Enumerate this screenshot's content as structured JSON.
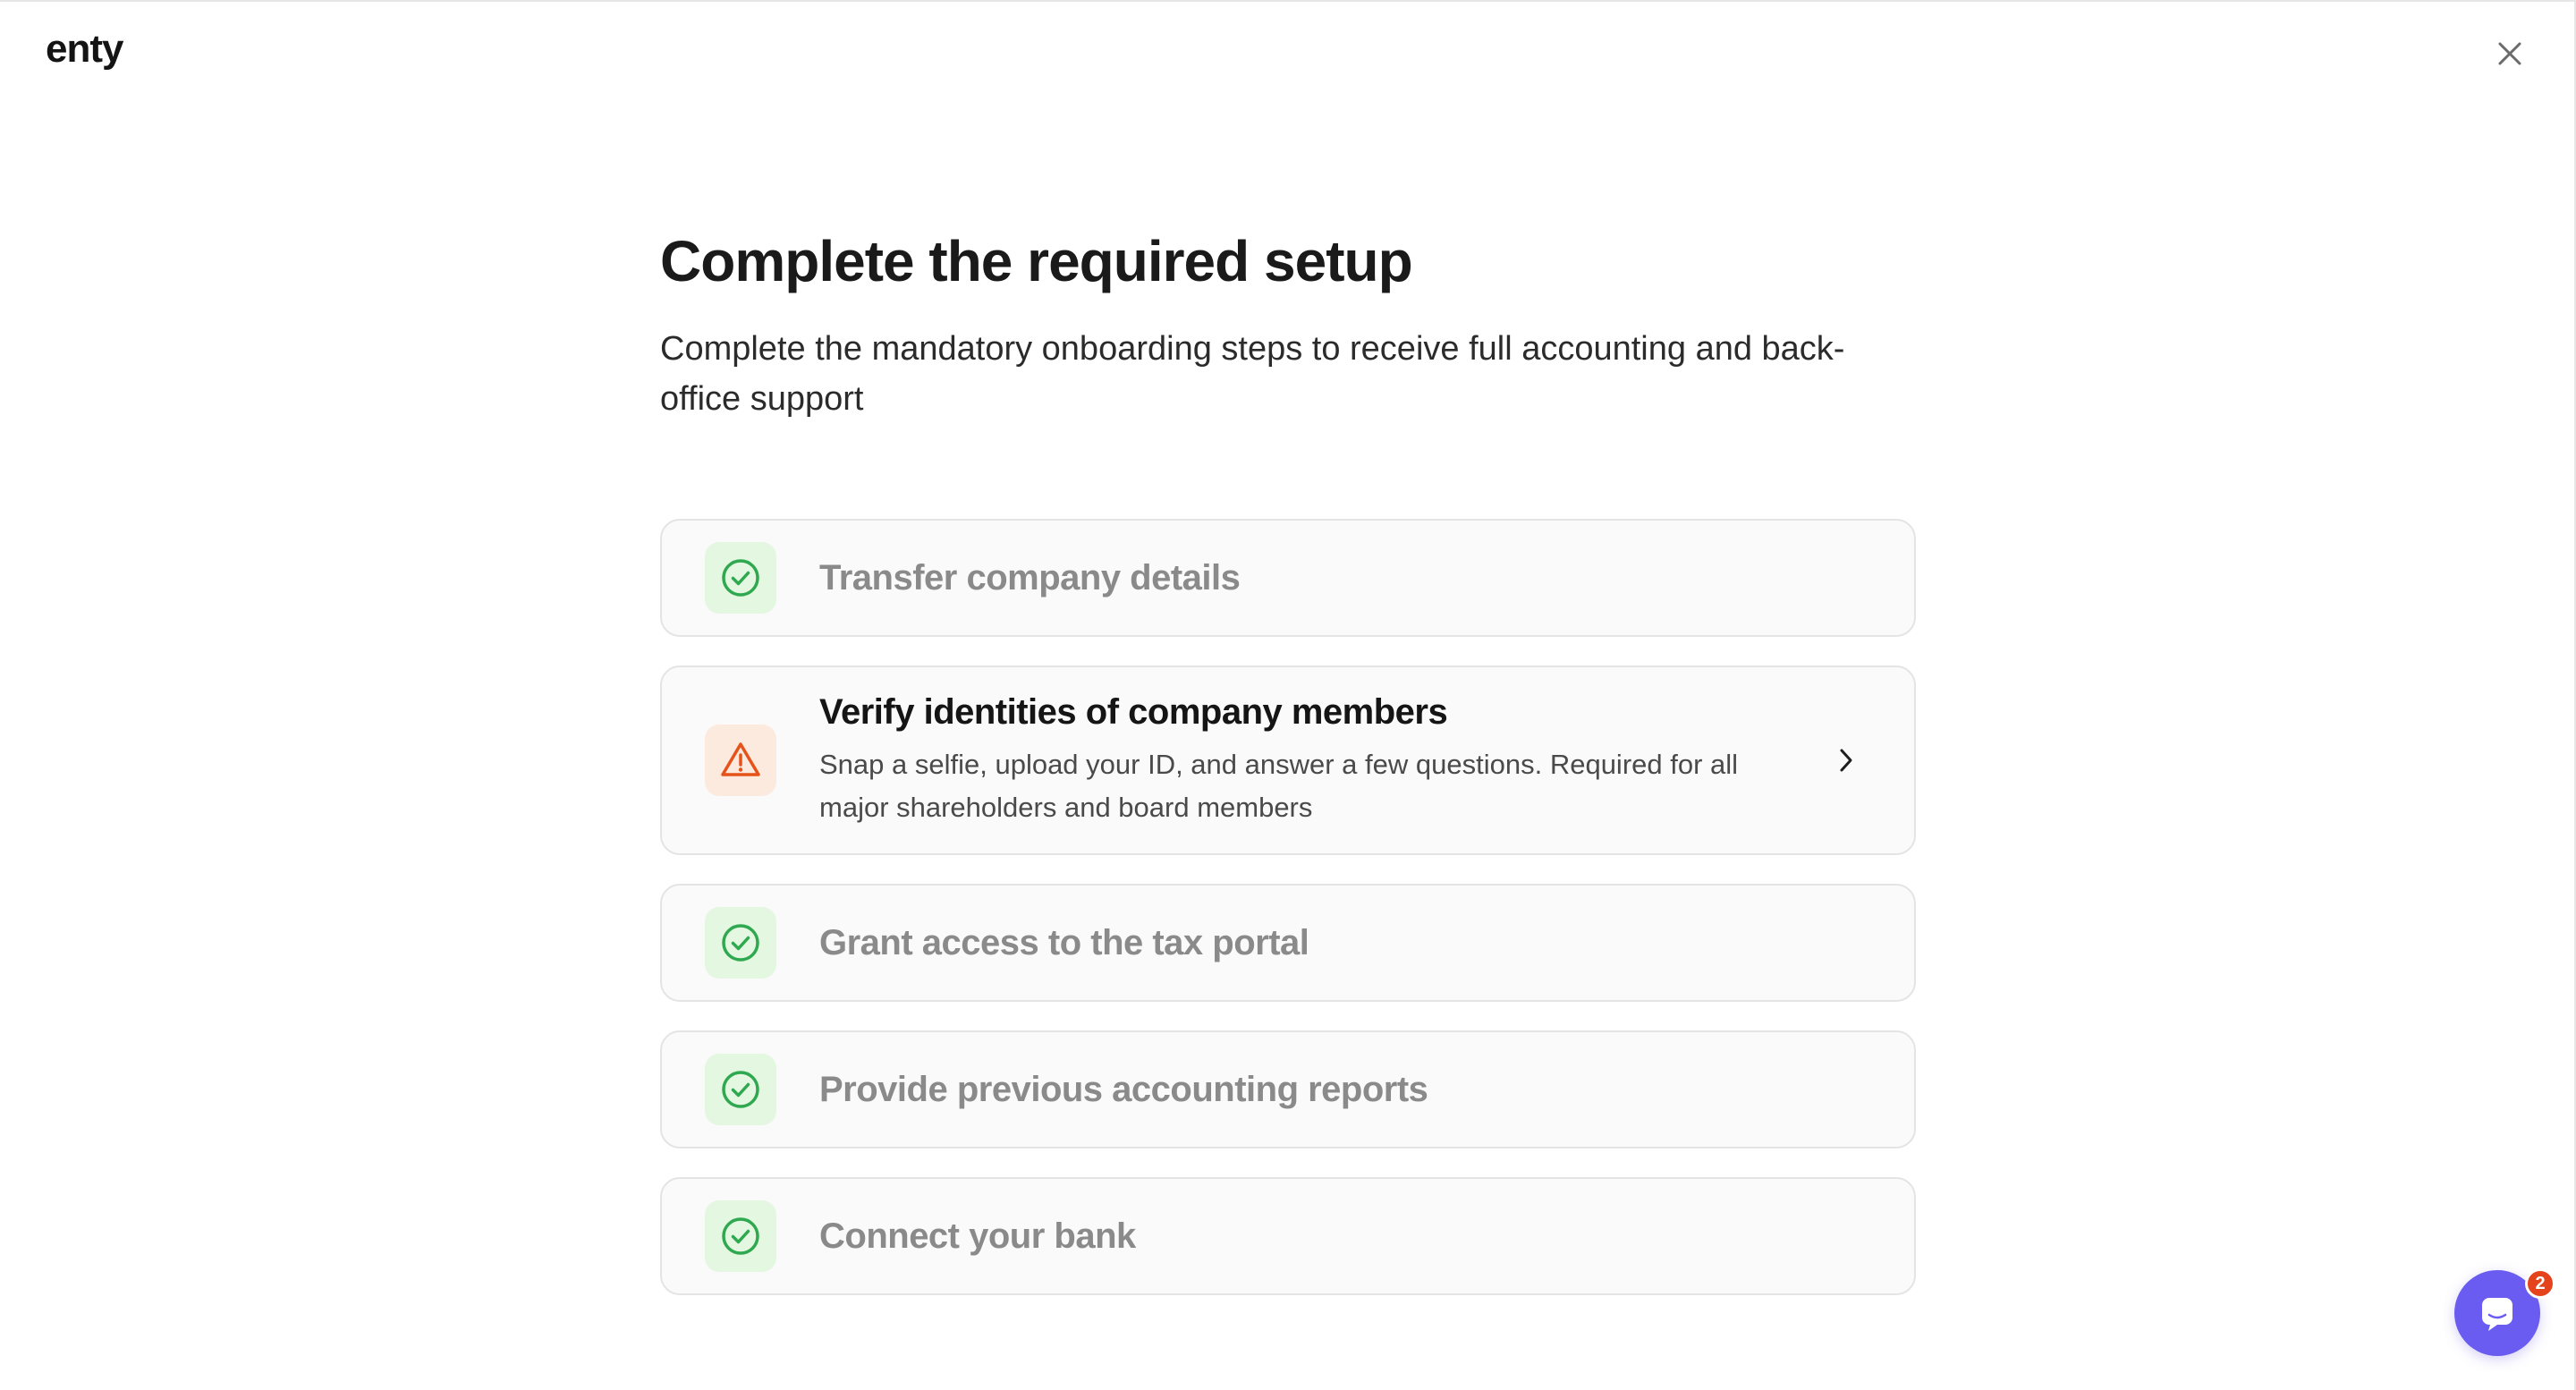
{
  "app": {
    "logo_text": "enty"
  },
  "header": {
    "close_icon": "close-icon"
  },
  "main": {
    "title": "Complete the required setup",
    "subtitle": "Complete the mandatory onboarding steps to receive full accounting and back-office support"
  },
  "steps": [
    {
      "title": "Transfer company details",
      "status": "completed",
      "icon": "check-circle-icon"
    },
    {
      "title": "Verify identities of company members",
      "description": "Snap a selfie, upload your ID, and answer a few questions. Required for all major shareholders and board members",
      "status": "action-required",
      "icon": "warning-triangle-icon"
    },
    {
      "title": "Grant access to the tax portal",
      "status": "completed",
      "icon": "check-circle-icon"
    },
    {
      "title": "Provide previous accounting reports",
      "status": "completed",
      "icon": "check-circle-icon"
    },
    {
      "title": "Connect your bank",
      "status": "completed",
      "icon": "check-circle-icon"
    }
  ],
  "chat": {
    "unread_count": "2",
    "icon": "chat-icon"
  },
  "colors": {
    "completed_green": "#2fa84f",
    "warning_orange": "#e5531a",
    "chat_purple": "#6a5cf0",
    "badge_red": "#e5431c"
  }
}
